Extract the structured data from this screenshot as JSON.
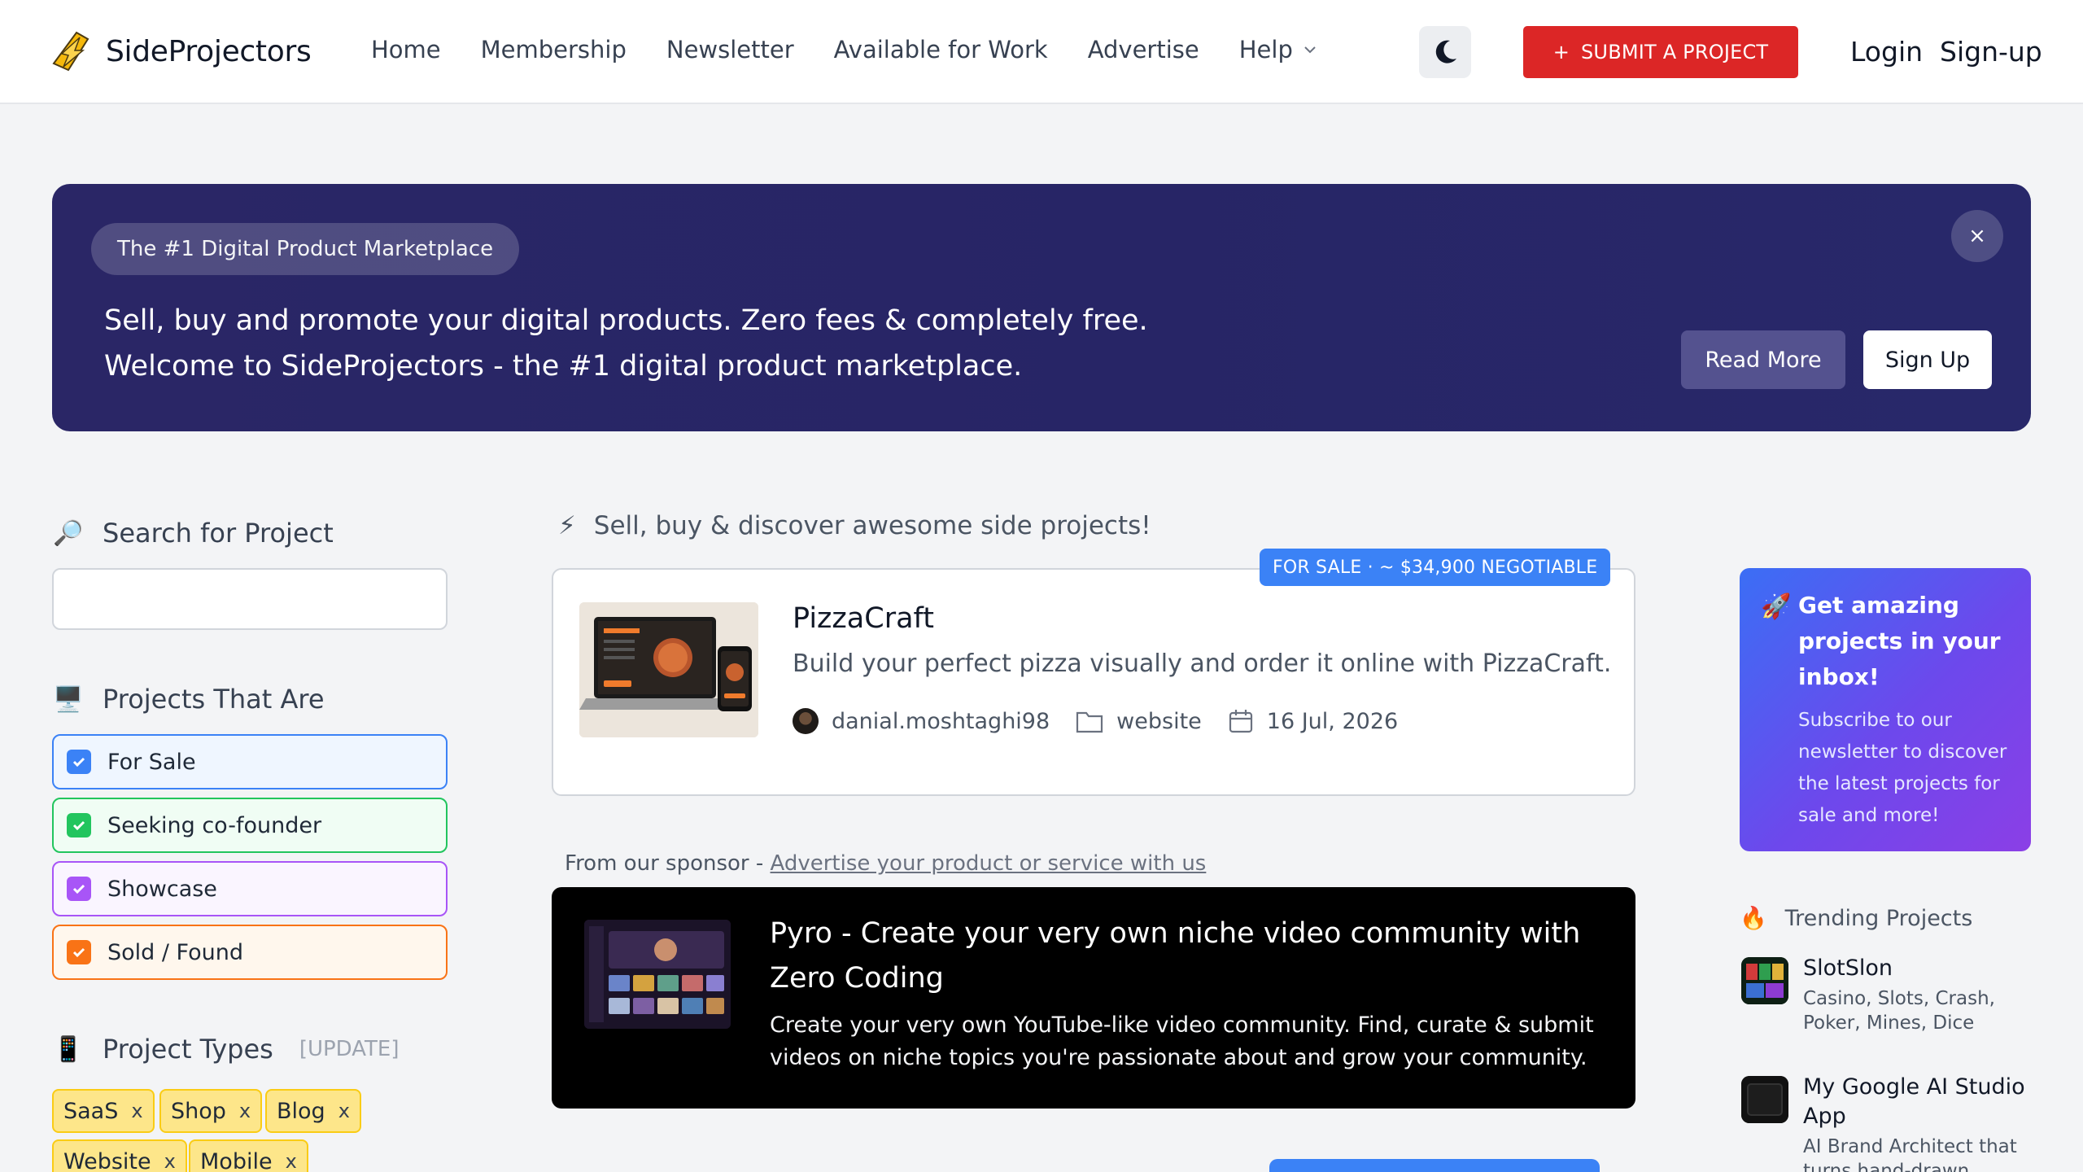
{
  "header": {
    "logo_text": "SideProjectors",
    "nav": [
      "Home",
      "Membership",
      "Newsletter",
      "Available for Work",
      "Advertise",
      "Help"
    ],
    "submit_label": "SUBMIT A PROJECT",
    "login": "Login",
    "signup": "Sign-up"
  },
  "hero": {
    "pill": "The #1 Digital Product Marketplace",
    "line1": "Sell, buy and promote your digital products. Zero fees & completely free.",
    "line2": "Welcome to SideProjectors - the #1 digital product marketplace.",
    "close": "×",
    "read_more": "Read More",
    "sign_up": "Sign Up"
  },
  "sidebar": {
    "search_title": "Search for Project",
    "search_emoji": "🔎",
    "search_value": "",
    "projects_that_are_title": "Projects That Are",
    "projects_that_are_emoji": "🖥️",
    "filters": [
      {
        "label": "For Sale",
        "color": "#3b82f6",
        "bg": "#eff6ff"
      },
      {
        "label": "Seeking co-founder",
        "color": "#22c55e",
        "bg": "#f0fdf4"
      },
      {
        "label": "Showcase",
        "color": "#a855f7",
        "bg": "#faf5ff"
      },
      {
        "label": "Sold / Found",
        "color": "#f97316",
        "bg": "#fff7ed"
      }
    ],
    "types_title": "Project Types",
    "types_emoji": "📱",
    "types_update": "[UPDATE]",
    "chips": [
      "SaaS",
      "Shop",
      "Blog",
      "Website",
      "Mobile"
    ],
    "chip_remove": "x"
  },
  "main": {
    "tagline_emoji": "⚡",
    "tagline": "Sell, buy & discover awesome side projects!",
    "project": {
      "badge": "FOR SALE · ~ $34,900 NEGOTIABLE",
      "title": "PizzaCraft",
      "description": "Build your perfect pizza visually and order it online with PizzaCraft.",
      "author": "danial.moshtaghi98",
      "category": "website",
      "date": "16 Jul, 2026"
    },
    "sponsor": {
      "prefix": "From our sponsor - ",
      "link": "Advertise your product or service with us",
      "title": "Pyro - Create your very own niche video community with Zero Coding",
      "description": "Create your very own YouTube-like video community. Find, curate & submit videos on niche topics you're passionate about and grow your community."
    }
  },
  "right": {
    "newsletter": {
      "emoji": "🚀",
      "title": "Get amazing projects in your inbox!",
      "description": "Subscribe to our newsletter to discover the latest projects for sale and more!"
    },
    "trending_emoji": "🔥",
    "trending_title": "Trending Projects",
    "trending": [
      {
        "name": "SlotSlon",
        "description": "Casino, Slots, Crash, Poker, Mines, Dice"
      },
      {
        "name": "My Google AI Studio App",
        "description": "AI Brand Architect that turns hand-drawn"
      }
    ]
  }
}
